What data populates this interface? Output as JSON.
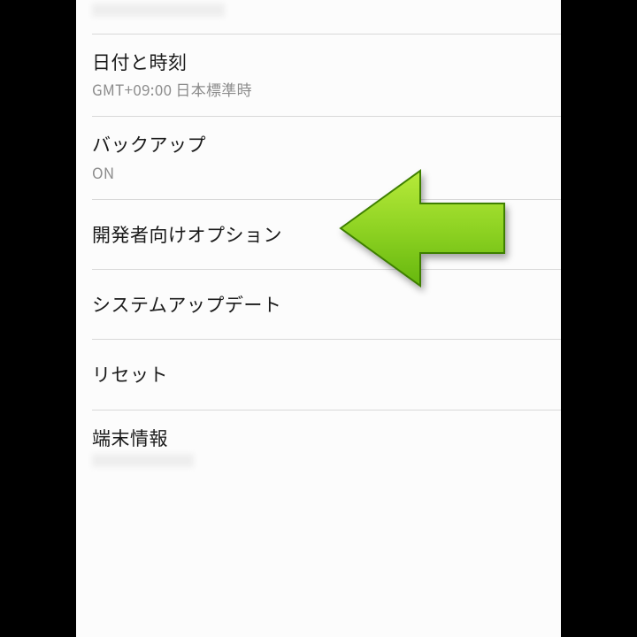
{
  "items": [
    {
      "title": "日付と時刻",
      "sub": "GMT+09:00 日本標準時"
    },
    {
      "title": "バックアップ",
      "sub": "ON"
    },
    {
      "title": "開発者向けオプション"
    },
    {
      "title": "システムアップデート"
    },
    {
      "title": "リセット"
    },
    {
      "title": "端末情報"
    }
  ],
  "annotation": {
    "type": "arrow-left",
    "color_stops": [
      "#b7ea3a",
      "#66b70e"
    ],
    "stroke": "#3e7f00",
    "points_to_item_index": 2
  }
}
